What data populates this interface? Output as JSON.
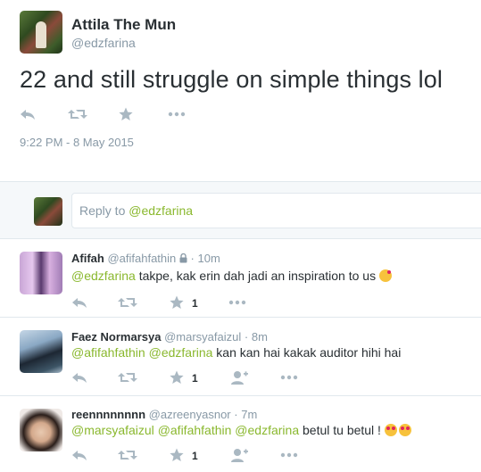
{
  "tweet": {
    "name": "Attila The Mun",
    "handle": "@edzfarina",
    "text": "22 and still struggle on simple things lol",
    "timestamp": "9:22 PM - 8 May 2015"
  },
  "reply_box": {
    "prefix": "Reply to ",
    "mention": "@edzfarina"
  },
  "replies": [
    {
      "name": "Afifah",
      "handle": "@afifahfathin",
      "time": "10m",
      "protected": true,
      "mentions": [
        "@edzfarina"
      ],
      "text": " takpe, kak erin dah jadi an inspiration to us ",
      "emoji": "kissing-heart",
      "favorites": "1"
    },
    {
      "name": "Faez Normarsya",
      "handle": "@marsyafaizul",
      "time": "8m",
      "mentions": [
        "@afifahfathin",
        "@edzfarina"
      ],
      "text": " kan kan hai kakak auditor hihi hai",
      "favorites": "1"
    },
    {
      "name": "reennnnnnnn",
      "handle": "@azreenyasnor",
      "time": "7m",
      "mentions": [
        "@marsyafaizul",
        "@afifahfathin",
        "@edzfarina"
      ],
      "text": " betul tu betul ! ",
      "emoji": "heart-eyes",
      "favorites": "1"
    }
  ],
  "colors": {
    "link": "#8ab82e",
    "muted": "#8899a6",
    "icon": "#aab8c2",
    "text": "#292f33"
  }
}
